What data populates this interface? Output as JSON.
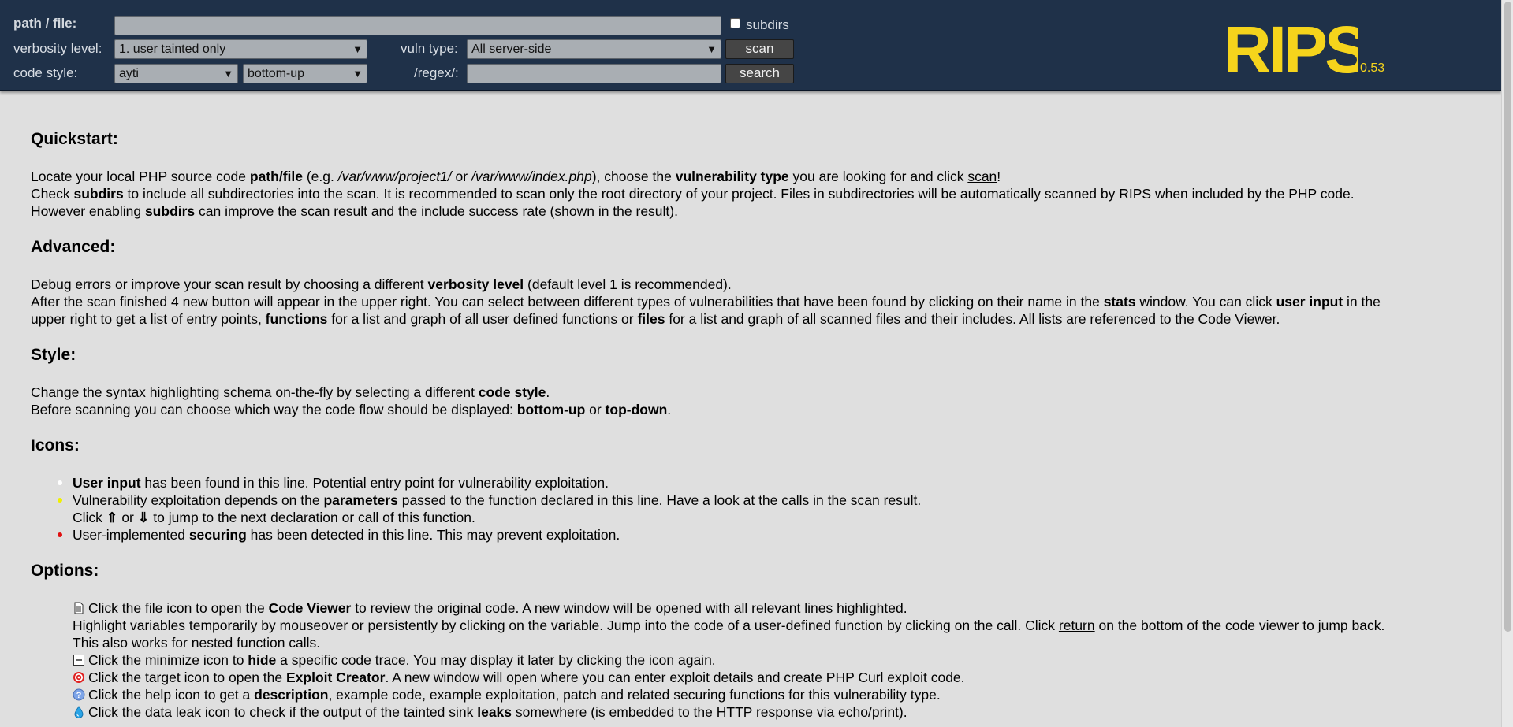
{
  "header": {
    "path_label": "path / file:",
    "path_value": "",
    "subdirs_label": "subdirs",
    "verbosity_label": "verbosity level:",
    "verbosity_value": "1. user tainted only",
    "vuln_label": "vuln type:",
    "vuln_value": "All server-side",
    "scan_button": "scan",
    "codestyle_label": "code style:",
    "codestyle_value": "ayti",
    "flow_value": "bottom-up",
    "regex_label": "/regex/:",
    "regex_value": "",
    "search_button": "search",
    "logo_text": "RIPS",
    "version": "0.53",
    "logo_color": "#f5d41c"
  },
  "quickstart": {
    "title": "Quickstart:",
    "l1": [
      "Locate your local PHP source code ",
      "path/file",
      " (e.g. ",
      "/var/www/project1/",
      " or ",
      "/var/www/index.php",
      "), choose the ",
      "vulnerability type",
      " you are looking for and click ",
      "scan",
      "!"
    ],
    "l2": [
      "Check ",
      "subdirs",
      " to include all subdirectories into the scan. It is recommended to scan only the root directory of your project. Files in subdirectories will be automatically scanned by RIPS when included by the PHP code."
    ],
    "l3": [
      "However enabling ",
      "subdirs",
      " can improve the scan result and the include success rate (shown in the result)."
    ]
  },
  "advanced": {
    "title": "Advanced:",
    "l1": [
      "Debug errors or improve your scan result by choosing a different ",
      "verbosity level",
      " (default level 1 is recommended)."
    ],
    "l2": [
      "After the scan finished 4 new button will appear in the upper right. You can select between different types of vulnerabilities that have been found by clicking on their name in the ",
      "stats",
      " window. You can click ",
      "user input",
      " in the"
    ],
    "l3": [
      "upper right to get a list of entry points, ",
      "functions",
      " for a list and graph of all user defined functions or ",
      "files",
      " for a list and graph of all scanned files and their includes. All lists are referenced to the Code Viewer."
    ]
  },
  "style": {
    "title": "Style:",
    "l1": [
      "Change the syntax highlighting schema on-the-fly by selecting a different ",
      "code style",
      "."
    ],
    "l2": [
      "Before scanning you can choose which way the code flow should be displayed: ",
      "bottom-up",
      " or ",
      "top-down",
      "."
    ]
  },
  "icons": {
    "title": "Icons:",
    "i1": [
      "User input",
      " has been found in this line. Potential entry point for vulnerability exploitation."
    ],
    "i2": [
      "Vulnerability exploitation depends on the ",
      "parameters",
      " passed to the function declared in this line. Have a look at the calls in the scan result."
    ],
    "i2b": [
      "Click ",
      "⇑",
      " or ",
      "⇓",
      " to jump to the next declaration or call of this function."
    ],
    "i3": [
      "User-implemented ",
      "securing",
      " has been detected in this line. This may prevent exploitation."
    ],
    "colors": {
      "user_input": "#ffffff",
      "parameters": "#f0f000",
      "securing": "#e01010"
    }
  },
  "options": {
    "title": "Options:",
    "o1": [
      "Click the file icon to open the ",
      "Code Viewer",
      " to review the original code. A new window will be opened with all relevant lines highlighted."
    ],
    "o1b": [
      "Highlight variables temporarily by mouseover or persistently by clicking on the variable. Jump into the code of a user-defined function by clicking on the call. Click ",
      "return",
      " on the bottom of the code viewer to jump back."
    ],
    "o1c": "This also works for nested function calls.",
    "o2": [
      "Click the minimize icon to ",
      "hide",
      " a specific code trace. You may display it later by clicking the icon again."
    ],
    "o3": [
      "Click the target icon to open the ",
      "Exploit Creator",
      ". A new window will open where you can enter exploit details and create PHP Curl exploit code."
    ],
    "o4": [
      "Click the help icon to get a ",
      "description",
      ", example code, example exploitation, patch and related securing functions for this vulnerability type."
    ],
    "o5": [
      "Click the data leak icon to check if the output of the tainted sink ",
      "leaks",
      " somewhere (is embedded to the HTTP response via echo/print)."
    ]
  }
}
